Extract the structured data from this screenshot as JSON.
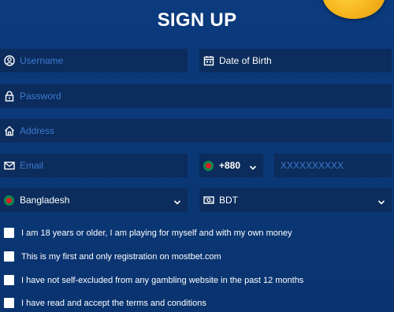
{
  "title": "SIGN UP",
  "form": {
    "username_placeholder": "Username",
    "dob_placeholder": "Date of Birth",
    "password_placeholder": "Password",
    "address_placeholder": "Address",
    "email_placeholder": "Email",
    "phone_code": "+880",
    "phone_placeholder": "XXXXXXXXXX",
    "country": "Bangladesh",
    "currency": "BDT"
  },
  "checkboxes": [
    {
      "label": "I am 18 years or older, I am playing for myself and with my own money",
      "checked": false
    },
    {
      "label": "This is my first and only registration on mostbet.com",
      "checked": false
    },
    {
      "label": "I have not self-excluded from any gambling website in the past 12 months",
      "checked": false
    },
    {
      "label": "I have read and accept the terms and conditions",
      "checked": false
    }
  ],
  "icons": {
    "username": "user-circle-icon",
    "dob": "calendar-icon",
    "password": "lock-icon",
    "address": "home-icon",
    "email": "envelope-icon",
    "currency": "currency-note-icon",
    "dropdown": "chevron-down-icon"
  },
  "colors": {
    "background": "#0b3a7e",
    "field": "#0b2c5c",
    "placeholder": "#3d7ad0",
    "text": "#ffffff",
    "flag_green": "#0c8a4a",
    "flag_red": "#e21b2a",
    "coin": "#f6b51c"
  }
}
